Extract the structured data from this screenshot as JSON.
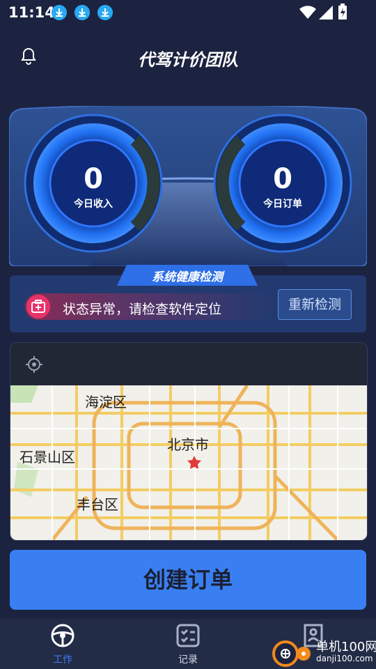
{
  "status_bar": {
    "time": "11:14"
  },
  "app_bar": {
    "title": "代驾计价团队"
  },
  "dashboard": {
    "income": {
      "value": "0",
      "label": "今日收入"
    },
    "orders": {
      "value": "0",
      "label": "今日订单"
    }
  },
  "health": {
    "title": "系统健康检测",
    "alert_text": "状态异常，请检查软件定位",
    "recheck_label": "重新检测"
  },
  "map": {
    "labels": {
      "haidian": "海淀区",
      "beijing": "北京市",
      "shijingshan": "石景山区",
      "fengtai": "丰台区"
    }
  },
  "create_order_label": "创建订单",
  "tabs": [
    {
      "label": "工作",
      "active": true
    },
    {
      "label": "记录",
      "active": false
    },
    {
      "label": "",
      "active": false
    }
  ],
  "watermark": {
    "text1": "单机100网",
    "text2": "danji100.com"
  },
  "colors": {
    "accent": "#3a7ff2",
    "alert": "#e8336a",
    "background": "#1c2340"
  }
}
